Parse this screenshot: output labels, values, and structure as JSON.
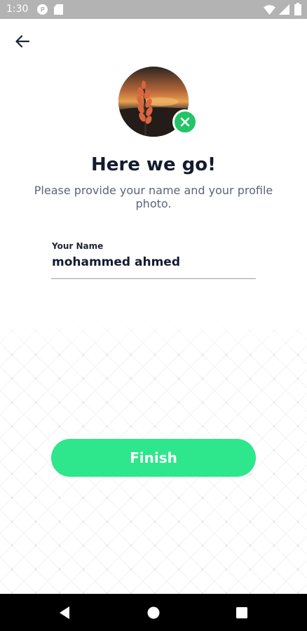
{
  "status_bar": {
    "time": "1:30",
    "icons": [
      "p-icon",
      "sd-card-icon",
      "wifi-icon",
      "signal-icon",
      "battery-icon"
    ]
  },
  "header": {
    "back_icon": "arrow-left-icon"
  },
  "profile": {
    "avatar": "profile-photo",
    "remove_icon": "close-icon"
  },
  "main": {
    "title": "Here we go!",
    "subtitle": "Please provide your name and your profile photo."
  },
  "form": {
    "name_label": "Your Name",
    "name_value": "mohammed ahmed"
  },
  "actions": {
    "finish_label": "Finish"
  },
  "nav_bar": {
    "icons": [
      "back-triangle-icon",
      "home-circle-icon",
      "recents-square-icon"
    ]
  },
  "colors": {
    "accent": "#2ee68b",
    "badge": "#23c468",
    "title": "#141b2e",
    "subtitle": "#5b6478"
  }
}
